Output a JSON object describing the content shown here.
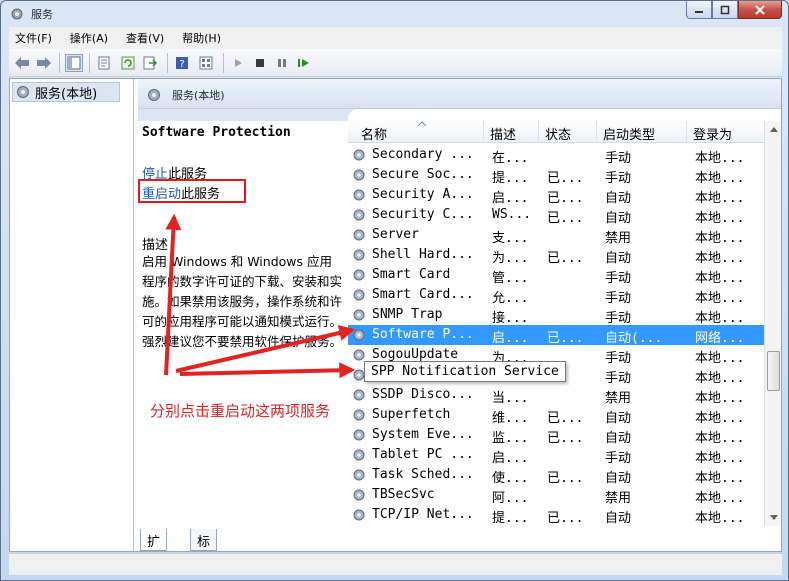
{
  "window": {
    "title": "服务",
    "controls": {
      "minimize": "minimize-icon",
      "maximize": "maximize-icon",
      "close": "close-icon"
    }
  },
  "menu": [
    "文件(F)",
    "操作(A)",
    "查看(V)",
    "帮助(H)"
  ],
  "toolbar_icons": [
    "back-arrow-icon",
    "forward-arrow-icon",
    "console-tree-icon",
    "properties-icon",
    "refresh-icon",
    "export-icon",
    "help-icon",
    "view-icon",
    "play-icon",
    "stop-icon",
    "pause-icon",
    "restart-icon"
  ],
  "tree": {
    "root_label": "服务(本地)"
  },
  "pane_header": "服务(本地)",
  "detail": {
    "service_name": "Software Protection",
    "stop_link": "停止",
    "stop_suffix": "此服务",
    "restart_link": "重启动",
    "restart_suffix": "此服务",
    "desc_label": "描述",
    "desc_text": "启用 Windows 和 Windows 应用程序的数字许可证的下载、安装和实施。如果禁用该服务，操作系统和许可的应用程序可能以通知模式运行。强烈建议您不要禁用软件保护服务。"
  },
  "annotation": {
    "instruction": "分别点击重启动这两项服务",
    "accent": "#e32222"
  },
  "columns": [
    "名称",
    "描述",
    "状态",
    "启动类型",
    "登录为"
  ],
  "services": [
    {
      "name": "Secondary ...",
      "desc": "在...",
      "status": "",
      "startup": "手动",
      "logon": "本地..."
    },
    {
      "name": "Secure Soc...",
      "desc": "提...",
      "status": "已...",
      "startup": "手动",
      "logon": "本地..."
    },
    {
      "name": "Security A...",
      "desc": "启...",
      "status": "已...",
      "startup": "自动",
      "logon": "本地..."
    },
    {
      "name": "Security C...",
      "desc": "WS...",
      "status": "已...",
      "startup": "自动",
      "logon": "本地..."
    },
    {
      "name": "Server",
      "desc": "支...",
      "status": "",
      "startup": "禁用",
      "logon": "本地..."
    },
    {
      "name": "Shell Hard...",
      "desc": "为...",
      "status": "已...",
      "startup": "自动",
      "logon": "本地..."
    },
    {
      "name": "Smart Card",
      "desc": "管...",
      "status": "",
      "startup": "手动",
      "logon": "本地..."
    },
    {
      "name": "Smart Card...",
      "desc": "允...",
      "status": "",
      "startup": "手动",
      "logon": "本地..."
    },
    {
      "name": "SNMP Trap",
      "desc": "接...",
      "status": "",
      "startup": "手动",
      "logon": "本地..."
    },
    {
      "name": "Software P...",
      "desc": "启...",
      "status": "已...",
      "startup": "自动(...",
      "logon": "网络...",
      "selected": true
    },
    {
      "name": "SogouUpdate",
      "desc": "为...",
      "status": "",
      "startup": "手动",
      "logon": "本地..."
    },
    {
      "name": "",
      "desc": "",
      "status": "",
      "startup": "手动",
      "logon": "本地..."
    },
    {
      "name": "SSDP Disco...",
      "desc": "当...",
      "status": "",
      "startup": "禁用",
      "logon": "本地..."
    },
    {
      "name": "Superfetch",
      "desc": "维...",
      "status": "已...",
      "startup": "自动",
      "logon": "本地..."
    },
    {
      "name": "System Eve...",
      "desc": "监...",
      "status": "已...",
      "startup": "自动",
      "logon": "本地..."
    },
    {
      "name": "Tablet PC ...",
      "desc": "启...",
      "status": "",
      "startup": "手动",
      "logon": "本地..."
    },
    {
      "name": "Task Sched...",
      "desc": "使...",
      "status": "已...",
      "startup": "自动",
      "logon": "本地..."
    },
    {
      "name": "TBSecSvc",
      "desc": "阿...",
      "status": "",
      "startup": "禁用",
      "logon": "本地..."
    },
    {
      "name": "TCP/IP Net...",
      "desc": "提...",
      "status": "已...",
      "startup": "自动",
      "logon": "本地..."
    }
  ],
  "tooltip": "SPP Notification Service",
  "tabs": [
    "扩展",
    "标准"
  ]
}
